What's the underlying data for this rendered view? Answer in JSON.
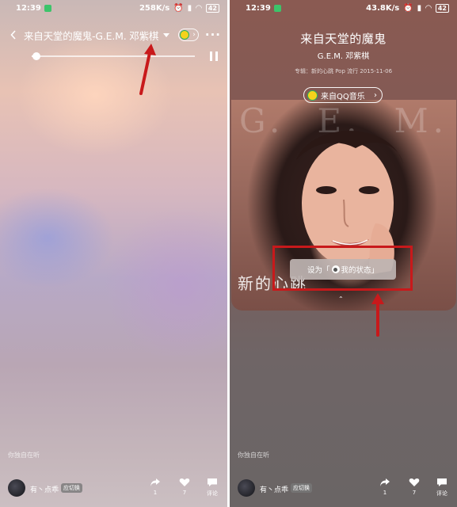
{
  "left": {
    "status": {
      "time": "12:39",
      "speed": "258K/s",
      "battery": "42"
    },
    "header": {
      "title": "来自天堂的魔鬼-G.E.M. 邓紫棋"
    },
    "player": {
      "progress_fraction": 0.03
    },
    "listening_text": "你独自在听",
    "bottom": {
      "username": "有丶点乖",
      "badge": "应切换",
      "share_count": "1",
      "like_count": "7",
      "comment_label": "评论"
    }
  },
  "right": {
    "status": {
      "time": "12:39",
      "speed": "43.8K/s",
      "battery": "42"
    },
    "song_title": "来自天堂的魔鬼",
    "artist": "G.E.M. 邓紫棋",
    "album_info": "专辑：新的心跳 Pop 流行 2015-11-06",
    "source_button": "来自QQ音乐",
    "cover": {
      "top_text": [
        "G.",
        "E.",
        "M."
      ],
      "bottom_text": "新的心跳"
    },
    "set_status": {
      "prefix": "设为「",
      "label": "我的状态」"
    },
    "listening_text": "你独自在听",
    "bottom": {
      "username": "有丶点乖",
      "badge": "应切换",
      "share_count": "1",
      "like_count": "7",
      "comment_label": "评论"
    }
  },
  "colors": {
    "annotation_red": "#c8191b",
    "qq_yellow": "#f6d21b",
    "qq_green": "#2bb35b"
  }
}
